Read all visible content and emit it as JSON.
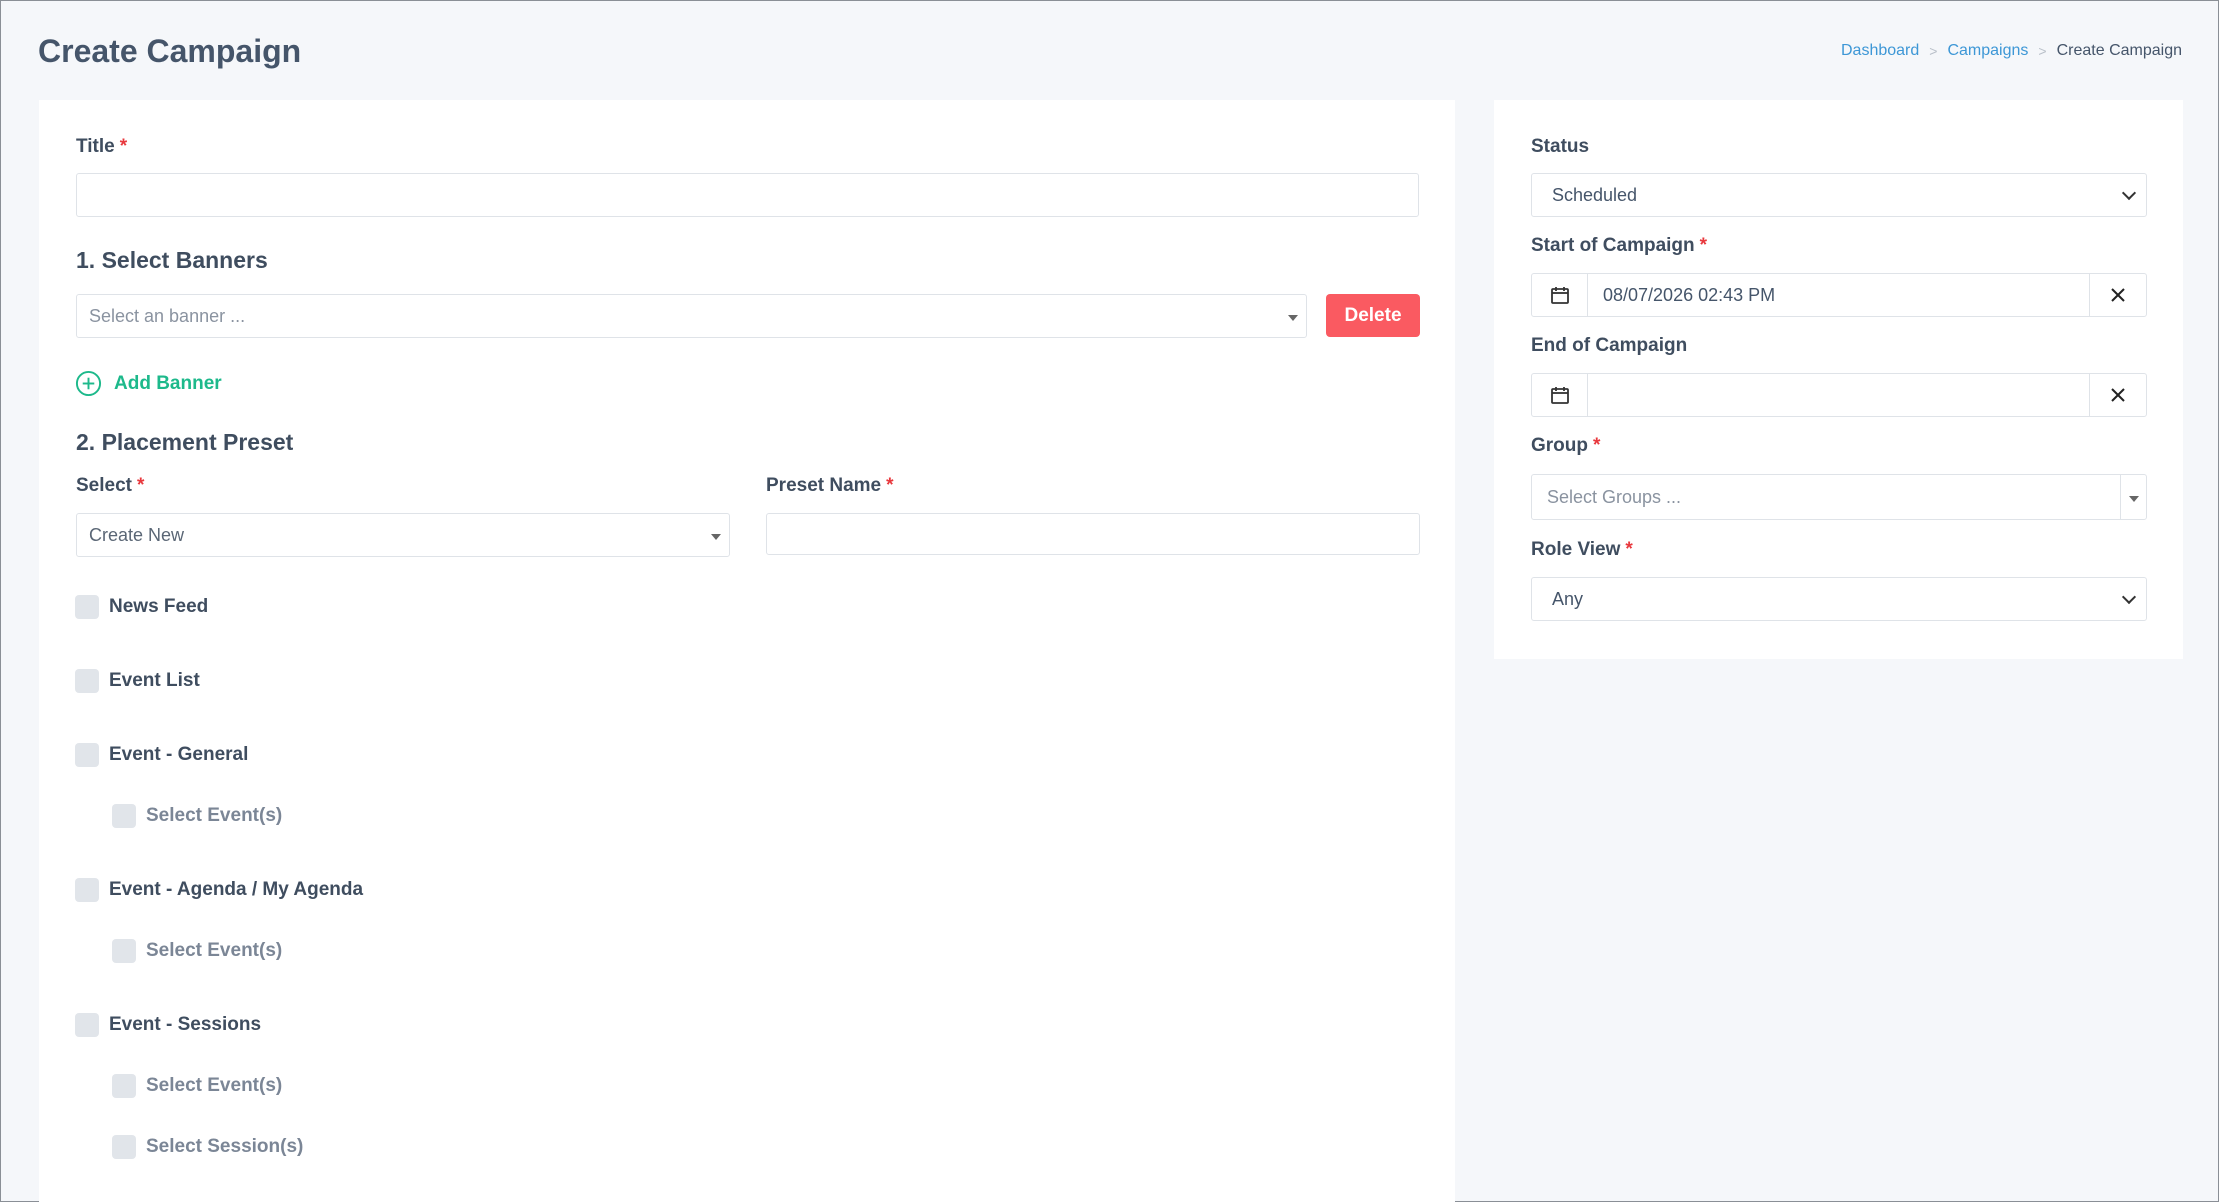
{
  "page": {
    "title": "Create Campaign",
    "breadcrumb": [
      {
        "label": "Dashboard",
        "link": true
      },
      {
        "label": "Campaigns",
        "link": true
      },
      {
        "label": "Create Campaign",
        "link": false
      }
    ],
    "breadcrumb_sep": ">"
  },
  "form": {
    "title_label": "Title",
    "title_value": "",
    "required_mark": "*",
    "banners": {
      "heading": "1. Select Banners",
      "placeholder": "Select an banner ...",
      "delete_label": "Delete",
      "add_label": "Add Banner"
    },
    "placement": {
      "heading": "2. Placement Preset",
      "select_label": "Select",
      "select_value": "Create New",
      "preset_name_label": "Preset Name",
      "preset_name_value": ""
    },
    "placements": [
      {
        "label": "News Feed"
      },
      {
        "label": "Event List"
      },
      {
        "label": "Event - General"
      },
      {
        "label": "Select Event(s)"
      },
      {
        "label": "Event - Agenda / My Agenda"
      },
      {
        "label": "Select Event(s)"
      },
      {
        "label": "Event - Sessions"
      },
      {
        "label": "Select Event(s)"
      },
      {
        "label": "Select Session(s)"
      }
    ]
  },
  "sidebar": {
    "status_label": "Status",
    "status_value": "Scheduled",
    "start_label": "Start of Campaign",
    "start_value": "08/07/2026 02:43 PM",
    "end_label": "End of Campaign",
    "end_value": "",
    "group_label": "Group",
    "group_placeholder": "Select Groups ...",
    "role_label": "Role View",
    "role_value": "Any"
  },
  "colors": {
    "accent_link": "#3d97d6",
    "delete_red": "#fa5a61",
    "add_green": "#1db98b",
    "required_red": "#e8383d"
  }
}
